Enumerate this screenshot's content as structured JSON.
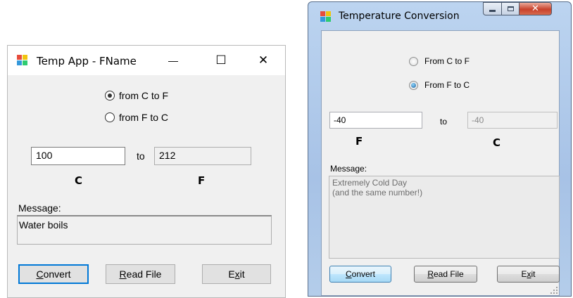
{
  "win1": {
    "title": "Temp App - FName",
    "controls": {
      "minimize": "—",
      "maximize": "☐",
      "close": "✕"
    },
    "radio_c_to_f": "from C to F",
    "radio_f_to_c": "from F to C",
    "selected": "from C to F",
    "input_value": "100",
    "to_label": "to",
    "output_value": "212",
    "input_unit": "C",
    "output_unit": "F",
    "message_label": "Message:",
    "message_text": "Water boils",
    "buttons": {
      "convert_mnemonic": "C",
      "convert_rest": "onvert",
      "read_mnemonic": "R",
      "read_rest": "ead File",
      "exit_pre": "E",
      "exit_mnemonic": "x",
      "exit_rest": "it"
    }
  },
  "win2": {
    "title": "Temperature Conversion",
    "radio_c_to_f": "From C to F",
    "radio_f_to_c": "From F to C",
    "selected": "From F to C",
    "input_value": "-40",
    "to_label": "to",
    "output_value": "-40",
    "input_unit": "F",
    "output_unit": "C",
    "message_label": "Message:",
    "message_line1": "Extremely Cold Day",
    "message_line2": "(and the same number!)",
    "buttons": {
      "convert_mnemonic": "C",
      "convert_rest": "onvert",
      "read_mnemonic": "R",
      "read_rest": "ead File",
      "exit_pre": "E",
      "exit_mnemonic": "x",
      "exit_rest": "it"
    }
  },
  "colors": {
    "win10_focus": "#0078d7",
    "win7_frame": "#a7c2e6",
    "win7_close": "#c8412b"
  }
}
